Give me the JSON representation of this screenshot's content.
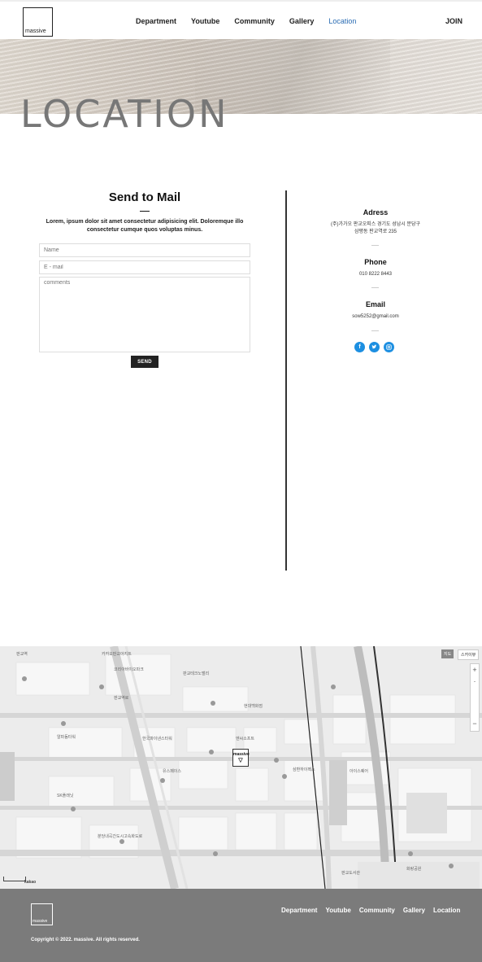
{
  "header": {
    "logo_text": "massive",
    "nav": [
      "Department",
      "Youtube",
      "Community",
      "Gallery",
      "Location"
    ],
    "join_label": "JOIN"
  },
  "hero": {
    "title": "LOCATION"
  },
  "mail": {
    "title": "Send to Mail",
    "description": "Lorem, ipsum dolor sit amet consectetur adipisicing elit. Doloremque illo consectetur cumque quos voluptas minus.",
    "name_placeholder": "Name",
    "email_placeholder": "E - mail",
    "comments_placeholder": "comments",
    "send_label": "SEND"
  },
  "contact": {
    "address_title": "Adress",
    "address_line1": "(주)가가오 판교오피스 경기도 성남시 분당구",
    "address_line2": "삼평동 판교역로 235",
    "phone_title": "Phone",
    "phone": "010 8222 8443",
    "email_title": "Email",
    "email": "sow5252@gmail.com",
    "social_icons": [
      "facebook-icon",
      "twitter-icon",
      "instagram-icon"
    ],
    "accent": "#1d8fe1"
  },
  "map": {
    "marker_label": "massive",
    "map_type_normal": "지도",
    "map_type_satellite": "스카이뷰",
    "kakao_label": "kakao",
    "labels": [
      "판교역",
      "카카오판교아지트",
      "판교테크노밸리",
      "유스페이스",
      "삼환하이펙스",
      "현대백화점",
      "판교역로",
      "알파돔타워",
      "엔씨소프트",
      "아이스퀘어",
      "코리아바이오파크",
      "한국파이낸스타워",
      "SK플래닛",
      "분당내곡간도시고속화도로",
      "판교도서관",
      "화랑공원"
    ]
  },
  "footer": {
    "logo_text": "massive",
    "nav": [
      "Department",
      "Youtube",
      "Community",
      "Gallery",
      "Location"
    ],
    "copyright": "Copyright © 2022. massive. All rights reserved."
  }
}
